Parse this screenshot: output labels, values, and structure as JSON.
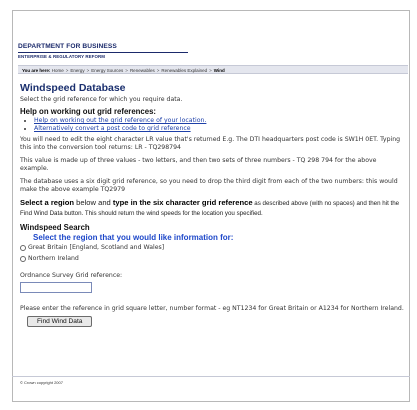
{
  "logo": {
    "line1": "DEPARTMENT FOR BUSINESS",
    "line2": "ENTERPRISE & REGULATORY REFORM"
  },
  "breadcrumb": {
    "prefix": "You are here:",
    "items": [
      "Home",
      "Energy",
      "Energy Sources",
      "Renewables",
      "Renewables Explained"
    ],
    "current": "Wind",
    "separator": ">"
  },
  "main": {
    "title": "Windspeed Database",
    "intro": "Select the grid reference for which you require data.",
    "help_heading": "Help on working out grid references:",
    "help_links": [
      "Help on working out the grid reference of your location.",
      "Alternatively convert a post code to grid reference"
    ],
    "para1": "You will need to edit the eight character LR value that's returned E.g. The DTI headquarters post code is SW1H 0ET. Typing this into the conversion tool returns: LR - TQ298794",
    "para2": "This value is made up of three values - two letters, and then two sets of three numbers - TQ 298 794  for the above example.",
    "para3": "The database uses a six digit grid reference, so you need to drop the third digit from each of the two numbers: this would make the above example TQ2979",
    "instr_pre": "Select a region",
    "instr_mid1": " below and ",
    "instr_bold": "type in the six character grid reference",
    "instr_post": " as described above (with no spaces) and then hit the Find Wind Data button. This should return the wind speeds for the location you specified.",
    "search_heading": "Windspeed Search",
    "region_question": "Select the region that you would like information for:",
    "regions": [
      "Great Britain [England, Scotland and Wales]",
      "Northern Ireland"
    ],
    "grid_label": "Ordnance Survey Grid reference:",
    "grid_value": "",
    "hint": "Please enter the reference in grid square letter, number format - eg NT1234 for Great Britain or A1234 for Northern Ireland.",
    "button": "Find Wind Data"
  },
  "footer": {
    "copyright": "© Crown copyright 2007"
  }
}
